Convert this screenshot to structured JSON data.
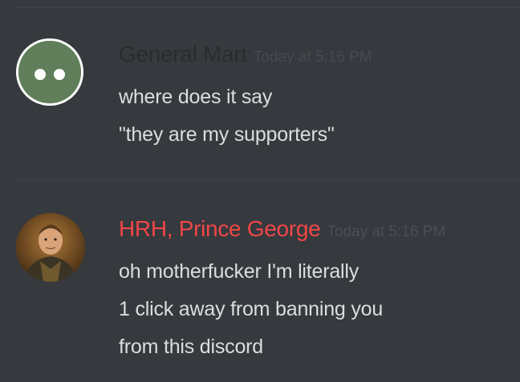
{
  "messages": [
    {
      "author": "General Mart",
      "author_color": "#2a2c2f",
      "timestamp": "Today at 5:16 PM",
      "avatar_icon": "green-circle-eyes-avatar",
      "lines": [
        "where does it say",
        "\"they are my supporters\""
      ]
    },
    {
      "author": "HRH, Prince George",
      "author_color": "#f04747",
      "timestamp": "Today at 5:16 PM",
      "avatar_icon": "portrait-photo-avatar",
      "lines": [
        "oh motherfucker I'm literally",
        "1 click away from banning you",
        "from this discord"
      ]
    }
  ],
  "colors": {
    "background": "#36393e",
    "text": "#dcddde",
    "divider": "#3f4248"
  }
}
